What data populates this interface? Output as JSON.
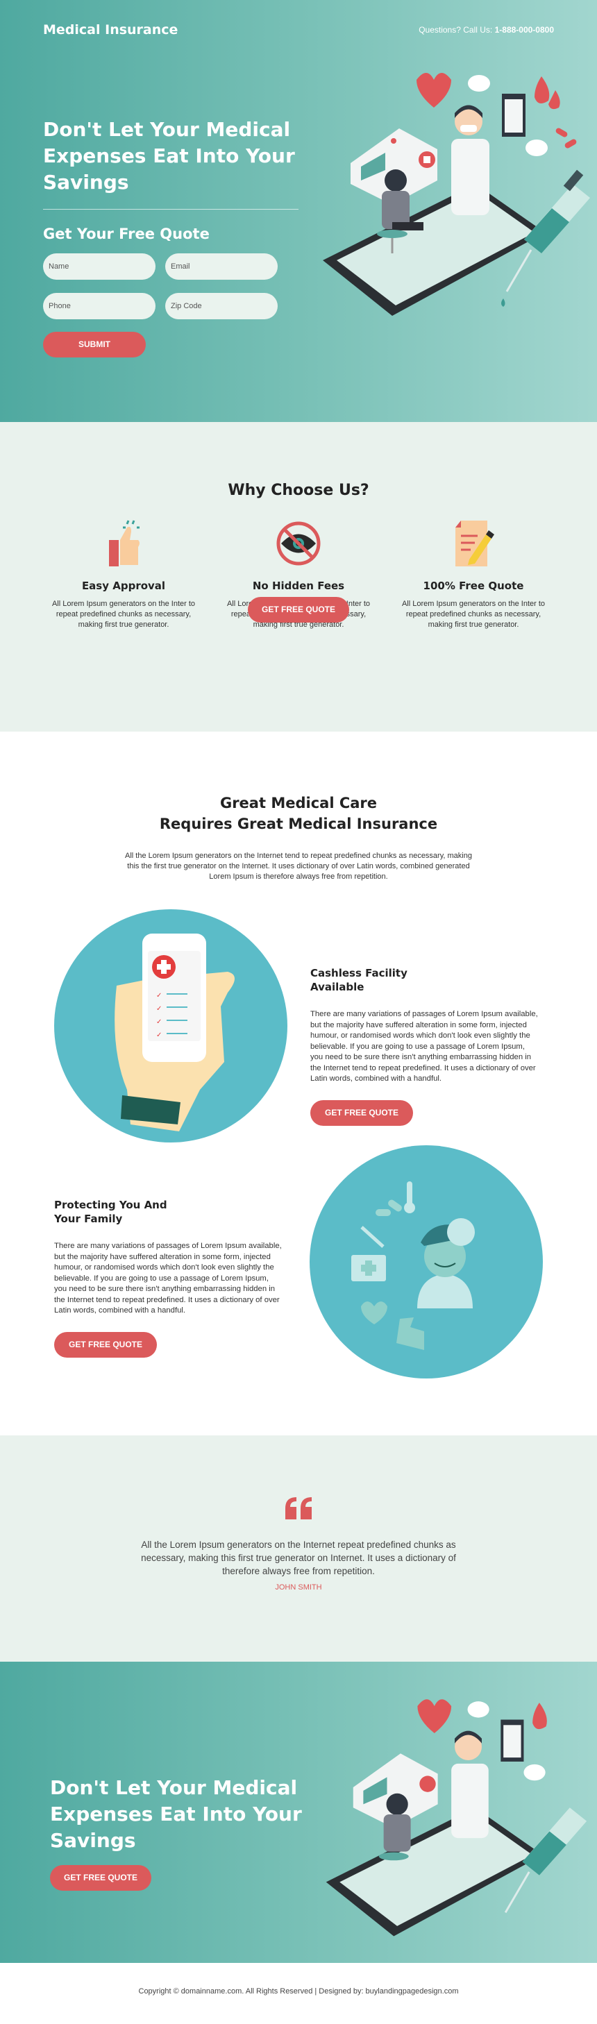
{
  "header": {
    "brand": "Medical Insurance",
    "phone_prefix": "Questions? Call Us: ",
    "phone_number": "1-888-000-0800"
  },
  "hero": {
    "title": "Don't Let Your Medical Expenses Eat Into Your Savings",
    "form_title": "Get Your Free Quote",
    "fields": {
      "name_placeholder": "Name",
      "email_placeholder": "Email",
      "phone_placeholder": "Phone",
      "zip_placeholder": "Zip Code"
    },
    "submit_label": "SUBMIT",
    "illustration": "telemedicine-illustration"
  },
  "why": {
    "title": "Why Choose Us?",
    "features": [
      {
        "icon": "thumbs-up-icon",
        "title": "Easy Approval",
        "text": "All Lorem Ipsum generators on the Inter to repeat predefined chunks as necessary, making first true generator."
      },
      {
        "icon": "no-eye-icon",
        "title": "No Hidden Fees",
        "text": "All Lorem Ipsum generators on the Inter to repeat predefined chunks as necessary, making first true generator."
      },
      {
        "icon": "document-pencil-icon",
        "title": "100% Free Quote",
        "text": "All Lorem Ipsum generators on the Inter to repeat predefined chunks as necessary, making first true generator."
      }
    ],
    "cta_label": "GET FREE QUOTE"
  },
  "care": {
    "title_line1": "Great Medical Care",
    "title_line2": "Requires Great Medical Insurance",
    "lead": "All the Lorem Ipsum generators on the Internet tend to repeat predefined chunks as necessary, making this the first true generator on the Internet. It uses dictionary of over Latin words, combined generated Lorem Ipsum is therefore always free from repetition.",
    "blocks": [
      {
        "title": "Cashless Facility Available",
        "text": "There are many variations of passages of Lorem Ipsum available, but the majority have suffered alteration in some form, injected humour, or randomised words which don't look even slightly the believable. If you are going to use a passage of Lorem Ipsum, you need to be sure there isn't anything embarrassing hidden in the Internet tend to repeat predefined. It uses a dictionary of over Latin words, combined with a handful.",
        "cta_label": "GET FREE QUOTE"
      },
      {
        "title": "Protecting You And Your Family",
        "text": "There are many variations of passages of Lorem Ipsum available, but the majority have suffered alteration in some form, injected humour, or randomised words which don't look even slightly the believable. If you are going to use a passage of Lorem Ipsum, you need to be sure there isn't anything embarrassing hidden in the Internet tend to repeat predefined. It uses a dictionary of over Latin words, combined with a handful.",
        "cta_label": "GET FREE QUOTE"
      }
    ]
  },
  "testimonial": {
    "quote": "All the Lorem Ipsum generators on the Internet repeat predefined chunks as necessary, making this first true generator on Internet. It uses a dictionary of therefore always free from repetition.",
    "author": "JOHN SMITH"
  },
  "cta_footer": {
    "title": "Don't Let Your Medical Expenses Eat Into Your Savings",
    "cta_label": "GET FREE QUOTE"
  },
  "footer": {
    "copyright": "Copyright © domainname.com. All Rights Reserved | Designed by: buylandingpagedesign.com"
  },
  "colors": {
    "accent": "#db5a5b",
    "teal_dark": "#4fa9a0",
    "teal_light": "#a2d6cf",
    "section_bg": "#e9f2ed",
    "circle_bg": "#5bbcc8"
  }
}
